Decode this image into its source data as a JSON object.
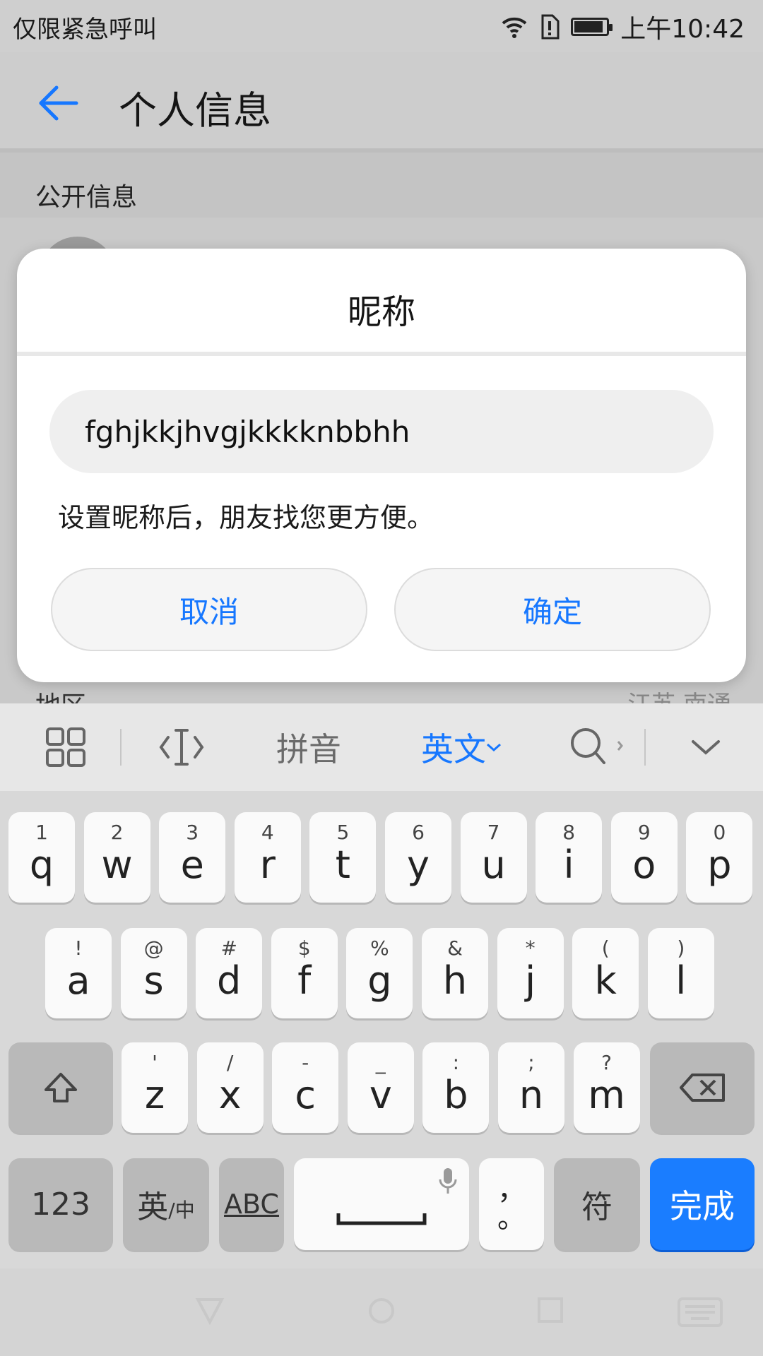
{
  "status_bar": {
    "left_text": "仅限紧急呼叫",
    "time": "上午10:42",
    "battery_level": 0.9,
    "icons": [
      "wifi-icon",
      "sim-alert-icon",
      "battery-icon"
    ]
  },
  "app_bar": {
    "back_icon": "arrow-left-icon",
    "title": "个人信息"
  },
  "background": {
    "section_label": "公开信息",
    "region_label": "地区",
    "region_value": "江苏 南通"
  },
  "dialog": {
    "title": "昵称",
    "input_value": "fghjkkjhvgjkkkknbbhh",
    "hint": "设置昵称后，朋友找您更方便。",
    "cancel_label": "取消",
    "confirm_label": "确定"
  },
  "keyboard": {
    "toolbar": {
      "pinyin_label": "拼音",
      "english_label": "英文",
      "icons": [
        "grid-icon",
        "text-cursor-icon",
        "search-icon",
        "collapse-chevron-icon"
      ]
    },
    "row1": [
      {
        "main": "q",
        "sub": "1"
      },
      {
        "main": "w",
        "sub": "2"
      },
      {
        "main": "e",
        "sub": "3"
      },
      {
        "main": "r",
        "sub": "4"
      },
      {
        "main": "t",
        "sub": "5"
      },
      {
        "main": "y",
        "sub": "6"
      },
      {
        "main": "u",
        "sub": "7"
      },
      {
        "main": "i",
        "sub": "8"
      },
      {
        "main": "o",
        "sub": "9"
      },
      {
        "main": "p",
        "sub": "0"
      }
    ],
    "row2": [
      {
        "main": "a",
        "sub": "!"
      },
      {
        "main": "s",
        "sub": "@"
      },
      {
        "main": "d",
        "sub": "#"
      },
      {
        "main": "f",
        "sub": "$"
      },
      {
        "main": "g",
        "sub": "%"
      },
      {
        "main": "h",
        "sub": "&"
      },
      {
        "main": "j",
        "sub": "*"
      },
      {
        "main": "k",
        "sub": "("
      },
      {
        "main": "l",
        "sub": ")"
      }
    ],
    "row3": [
      {
        "main": "z",
        "sub": "'"
      },
      {
        "main": "x",
        "sub": "/"
      },
      {
        "main": "c",
        "sub": "-"
      },
      {
        "main": "v",
        "sub": "_"
      },
      {
        "main": "b",
        "sub": ":"
      },
      {
        "main": "n",
        "sub": ";"
      },
      {
        "main": "m",
        "sub": "?"
      }
    ],
    "row4": {
      "num_label": "123",
      "lang_label_main": "英",
      "lang_label_sub": "/中",
      "abc_label": "ABC",
      "comma_label": "，",
      "period_label": "。",
      "symbol_label": "符",
      "done_label": "完成"
    }
  },
  "nav_bar": {
    "icons": [
      "back-triangle-icon",
      "home-circle-icon",
      "recents-square-icon",
      "keyboard-icon"
    ]
  }
}
